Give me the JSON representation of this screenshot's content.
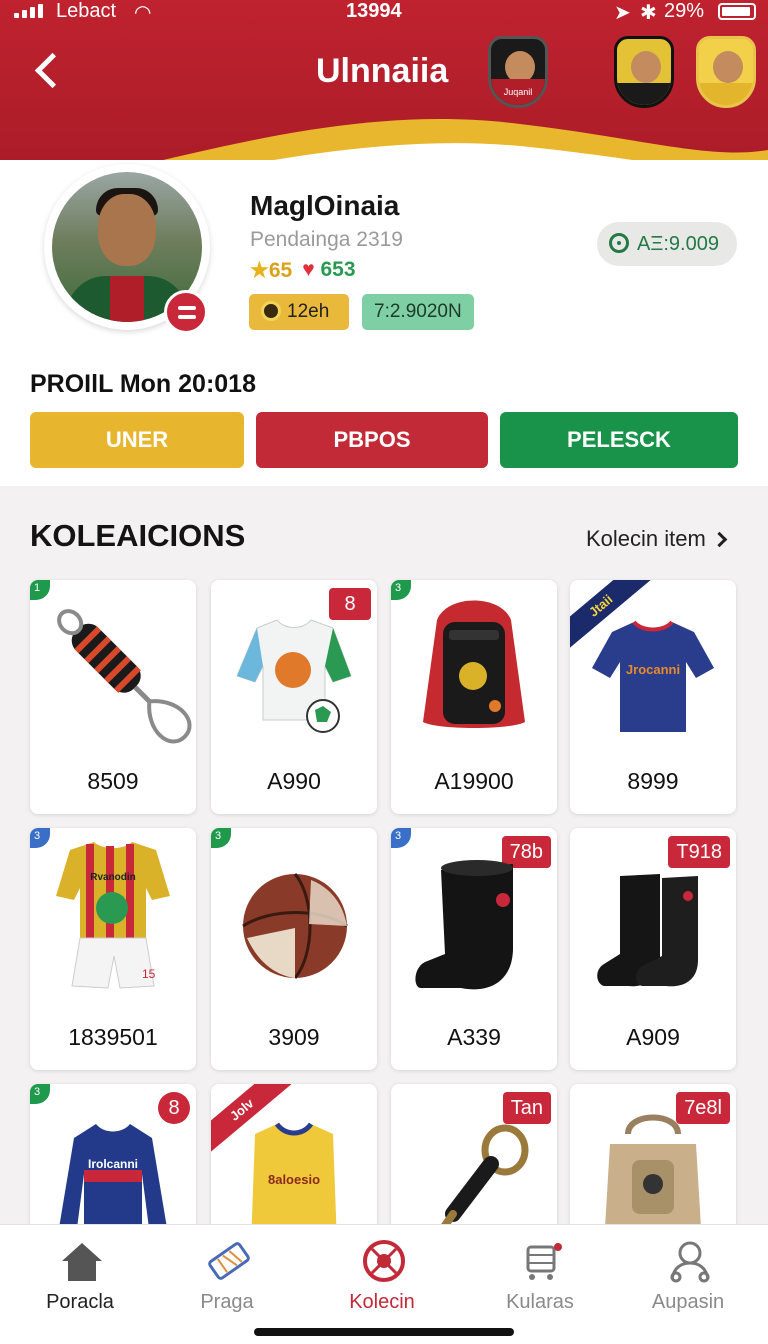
{
  "status_bar": {
    "carrier": "Lebact",
    "time": "13994",
    "battery": "29%"
  },
  "header": {
    "title": "Ulnnaiia",
    "badges": [
      {
        "label": "Juqanil"
      }
    ]
  },
  "profile": {
    "name": "MaglOinaia",
    "subtitle": "Pendainga 2319",
    "stars": "65",
    "hearts": "653",
    "chip_gold": "12eh",
    "chip_green": "7:2.9020N",
    "points": "AΞ:9.009",
    "since": "PROIlL Mon 20:018",
    "buttons": {
      "user": "UNER",
      "props": "PBPOS",
      "pelesck": "PELESCK"
    }
  },
  "collections": {
    "title": "KOLEAICIONS",
    "link": "Kolecin item",
    "items": [
      {
        "price": "8509",
        "corner": "1",
        "kind": "grip"
      },
      {
        "price": "A990",
        "tag": "8",
        "kind": "jersey-white"
      },
      {
        "price": "A19900",
        "corner": "3",
        "kind": "backpack"
      },
      {
        "price": "8999",
        "ribbon": "Jtaii",
        "kind": "jersey-navy"
      },
      {
        "price": "1839501",
        "corner": "3",
        "kind": "kit"
      },
      {
        "price": "3909",
        "corner": "3",
        "kind": "ball"
      },
      {
        "price": "A339",
        "corner": "3",
        "tag": "78b",
        "kind": "sock"
      },
      {
        "price": "A909",
        "tag": "T918",
        "kind": "socks"
      },
      {
        "price": "",
        "corner": "3",
        "tag": "8",
        "kind": "longsleeve"
      },
      {
        "price": "",
        "ribbon": "Jolv",
        "kind": "jersey-yellow"
      },
      {
        "price": "",
        "tag": "Tan",
        "kind": "whistle"
      },
      {
        "price": "",
        "tag": "7e8l",
        "kind": "pack"
      }
    ],
    "labels": {
      "jersey_navy_print": "Jrocanni",
      "kit_print": "Rvanodin",
      "longsleeve_print": "Irolcanni",
      "jersey_yellow_print": "8aloesio",
      "kit_number": "15"
    }
  },
  "tabbar": {
    "tabs": [
      {
        "label": "Poracla"
      },
      {
        "label": "Praga"
      },
      {
        "label": "Kolecin"
      },
      {
        "label": "Kularas"
      },
      {
        "label": "Aupasin"
      }
    ]
  },
  "colors": {
    "primary_red": "#c0222f",
    "gold": "#e7b52e",
    "green": "#19924a"
  }
}
